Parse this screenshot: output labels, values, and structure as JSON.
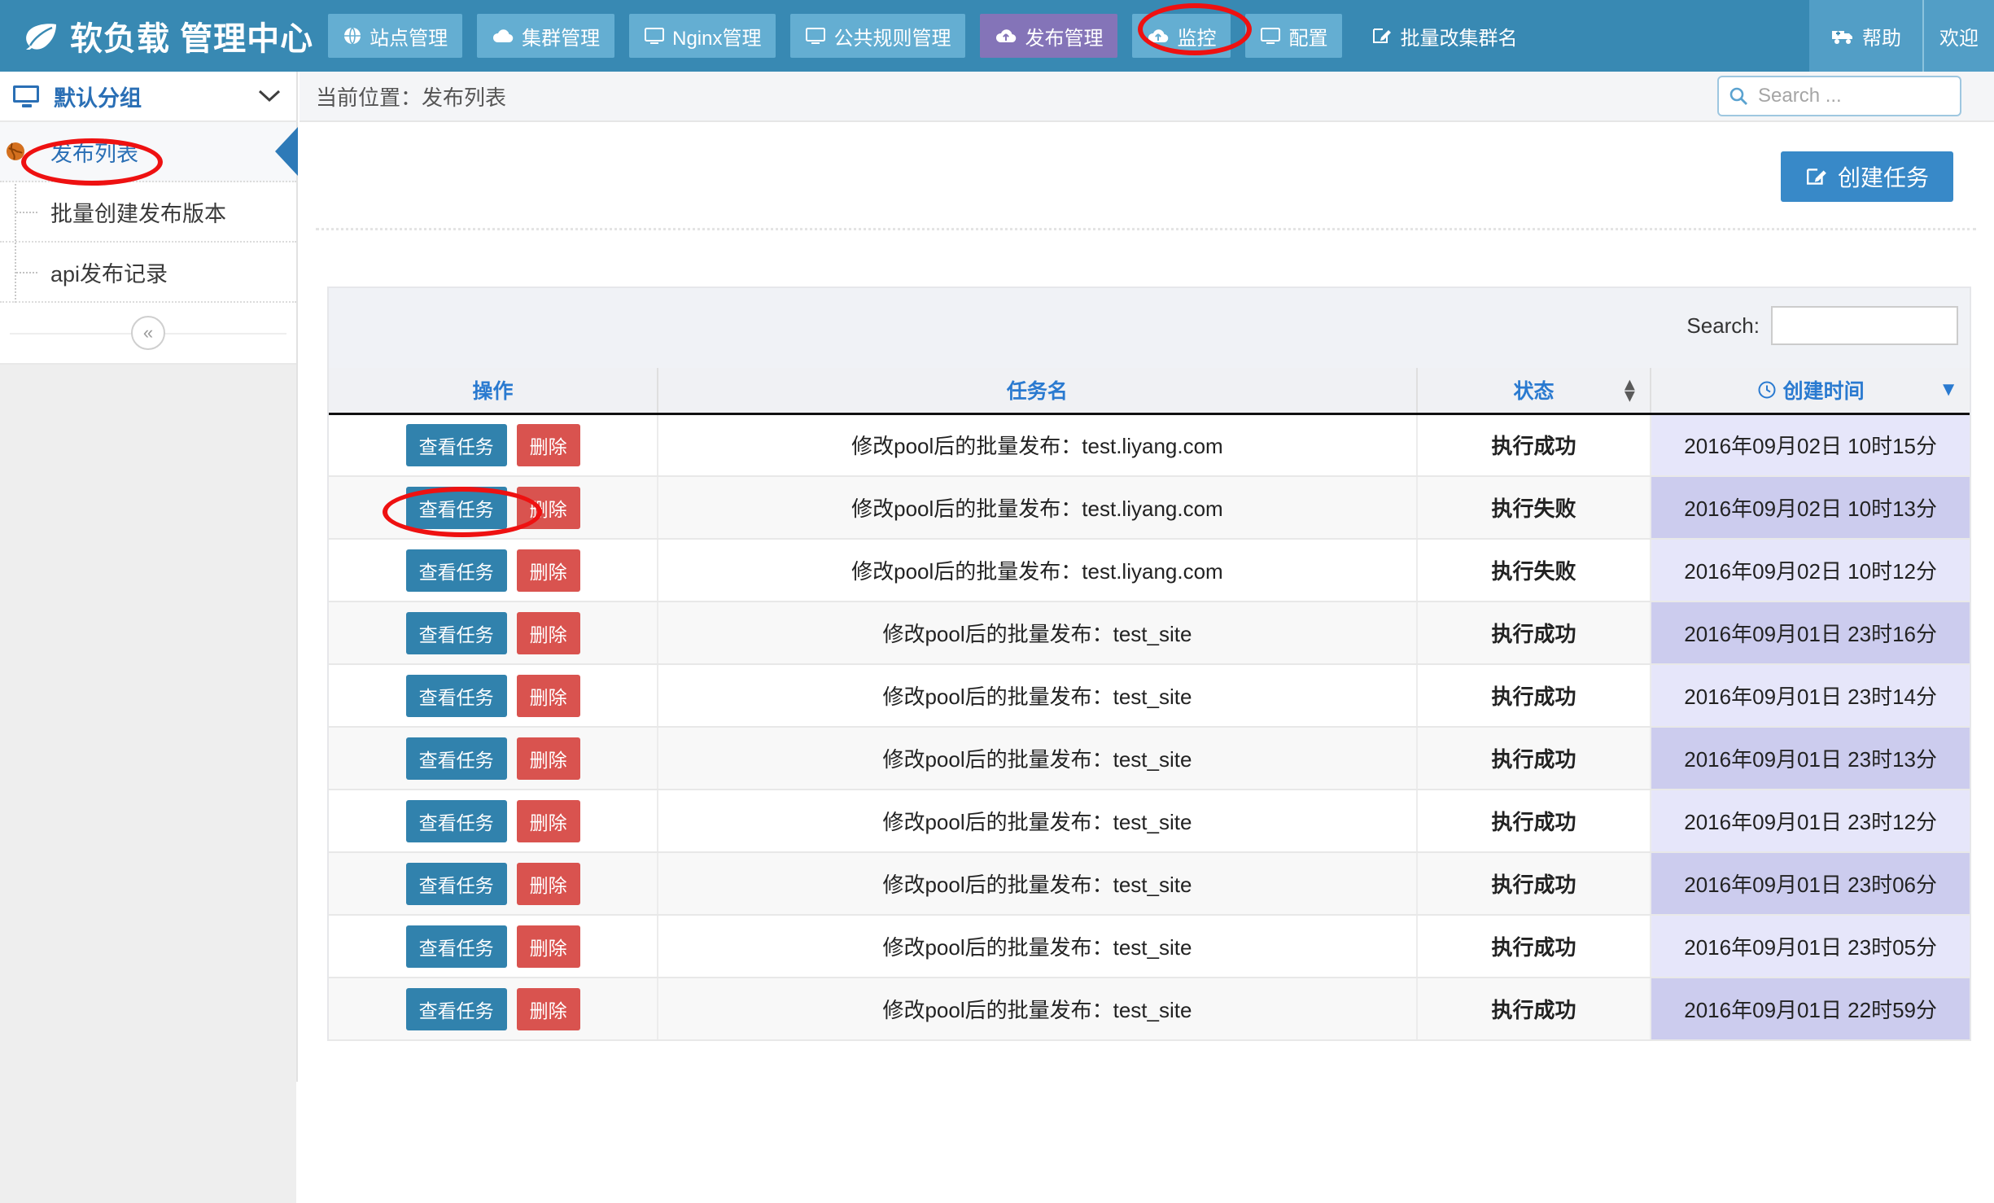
{
  "header": {
    "brand": "软负载 管理中心",
    "brand_icon": "leaf-icon",
    "nav": [
      {
        "label": "站点管理",
        "icon": "globe-icon",
        "active": false
      },
      {
        "label": "集群管理",
        "icon": "cloud-icon",
        "active": false
      },
      {
        "label": "Nginx管理",
        "icon": "monitor-icon",
        "active": false
      },
      {
        "label": "公共规则管理",
        "icon": "monitor-icon",
        "active": false
      },
      {
        "label": "发布管理",
        "icon": "cloud-upload-icon",
        "active": true
      },
      {
        "label": "监控",
        "icon": "cloud-upload-icon",
        "active": false
      },
      {
        "label": "配置",
        "icon": "monitor-icon",
        "active": false
      },
      {
        "label": "批量改集群名",
        "icon": "edit-square-icon",
        "active": false
      }
    ],
    "help_label": "帮助",
    "help_icon": "ambulance-icon",
    "welcome_label": "欢迎",
    "accent_active": "#8474b8",
    "accent_bar": "#3889b3"
  },
  "sidebar": {
    "group_title": "默认分组",
    "group_icon": "monitor-icon",
    "chevron_icon": "chevron-down-icon",
    "items": [
      {
        "label": "发布列表",
        "active": true,
        "icon": "globe-icon"
      },
      {
        "label": "批量创建发布版本",
        "active": false,
        "icon": ""
      },
      {
        "label": "api发布记录",
        "active": false,
        "icon": ""
      }
    ],
    "collapse_icon": "«"
  },
  "breadcrumb": {
    "prefix": "当前位置：",
    "current": "发布列表"
  },
  "top_search": {
    "placeholder": "Search ...",
    "value": "",
    "icon": "search-icon"
  },
  "toolbar": {
    "create_label": "创建任务",
    "create_icon": "edit-square-icon"
  },
  "table_search": {
    "label": "Search:",
    "value": "",
    "placeholder": ""
  },
  "table": {
    "columns": [
      {
        "label": "操作",
        "sort": "none",
        "icon": ""
      },
      {
        "label": "任务名",
        "sort": "none",
        "icon": ""
      },
      {
        "label": "状态",
        "sort": "both",
        "icon": ""
      },
      {
        "label": "创建时间",
        "sort": "desc",
        "icon": "clock-icon"
      }
    ],
    "row_actions": {
      "view": "查看任务",
      "delete": "删除"
    },
    "status_ok": "执行成功",
    "status_fail": "执行失败",
    "status_ok_color": "#0a9b0a",
    "status_fail_color": "#e00000",
    "rows": [
      {
        "name": "修改pool后的批量发布：test.liyang.com",
        "status": "执行成功",
        "ok": true,
        "time": "2016年09月02日 10时15分"
      },
      {
        "name": "修改pool后的批量发布：test.liyang.com",
        "status": "执行失败",
        "ok": false,
        "time": "2016年09月02日 10时13分"
      },
      {
        "name": "修改pool后的批量发布：test.liyang.com",
        "status": "执行失败",
        "ok": false,
        "time": "2016年09月02日 10时12分"
      },
      {
        "name": "修改pool后的批量发布：test_site",
        "status": "执行成功",
        "ok": true,
        "time": "2016年09月01日 23时16分"
      },
      {
        "name": "修改pool后的批量发布：test_site",
        "status": "执行成功",
        "ok": true,
        "time": "2016年09月01日 23时14分"
      },
      {
        "name": "修改pool后的批量发布：test_site",
        "status": "执行成功",
        "ok": true,
        "time": "2016年09月01日 23时13分"
      },
      {
        "name": "修改pool后的批量发布：test_site",
        "status": "执行成功",
        "ok": true,
        "time": "2016年09月01日 23时12分"
      },
      {
        "name": "修改pool后的批量发布：test_site",
        "status": "执行成功",
        "ok": true,
        "time": "2016年09月01日 23时06分"
      },
      {
        "name": "修改pool后的批量发布：test_site",
        "status": "执行成功",
        "ok": true,
        "time": "2016年09月01日 23时05分"
      },
      {
        "name": "修改pool后的批量发布：test_site",
        "status": "执行成功",
        "ok": true,
        "time": "2016年09月01日 22时59分"
      }
    ]
  },
  "annotations": {
    "color": "#ee1111",
    "marks": [
      {
        "target": "nav-publish-management"
      },
      {
        "target": "sidebar-publish-list"
      },
      {
        "target": "first-row-view-task"
      }
    ]
  }
}
